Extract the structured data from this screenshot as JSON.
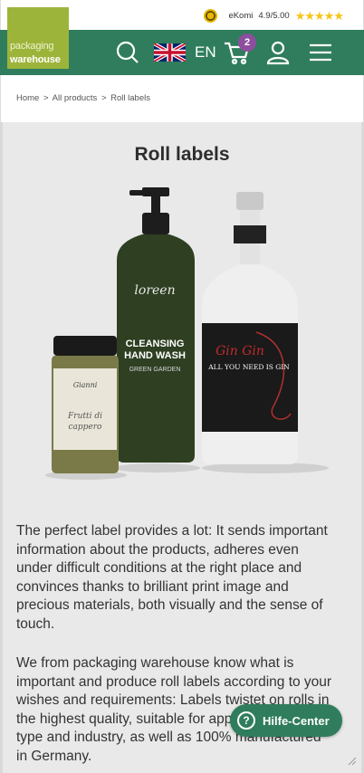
{
  "ekomi": {
    "label": "eKomi",
    "rating": "4.9/5.00",
    "stars": "★★★★★"
  },
  "logo": {
    "line1": "packaging",
    "line2": "warehouse"
  },
  "header": {
    "language_code": "EN",
    "cart_count": "2"
  },
  "breadcrumb": {
    "home": "Home",
    "sep1": ">",
    "all_products": "All products",
    "sep2": ">",
    "current": "Roll labels"
  },
  "page": {
    "title": "Roll labels"
  },
  "products": {
    "bottle_label_1": "loreen",
    "bottle_label_2": "CLEANSING",
    "bottle_label_3": "HAND WASH",
    "bottle_label_4": "GREEN GARDEN",
    "gin_label_1": "Gin Gin",
    "gin_label_2": "ALL YOU NEED IS GIN",
    "jar_label_1": "Gianni",
    "jar_label_2": "Frutti di",
    "jar_label_3": "cappero"
  },
  "content": {
    "para1": "The perfect label provides a lot: It sends important information about the products, adheres even under difficult conditions at the right place and convinces thanks to brilliant print image and precious materials, both visually and the sense of touch.",
    "para2": "We from packaging warehouse know what is important and produce roll labels according to your wishes and requirements: Labels twistet on rolls in the highest quality, suitable for application, product type and industry, as well as 100% manufactured in Germany."
  },
  "help": {
    "label": "Hilfe-Center",
    "icon": "?"
  },
  "colors": {
    "header_green": "#2f7d5c",
    "logo_green": "#9db43b",
    "badge_purple": "#8e4e9e"
  }
}
